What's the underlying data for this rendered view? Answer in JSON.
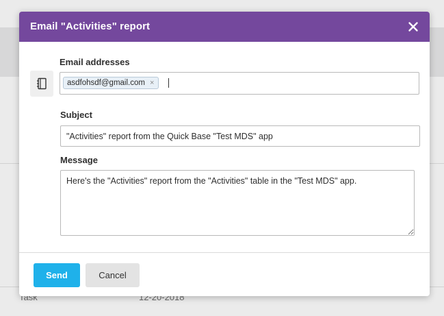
{
  "background": {
    "row_type": "Task",
    "row_date": "12-20-2018"
  },
  "dialog": {
    "title": "Email \"Activities\" report",
    "close_label": "×",
    "email": {
      "label": "Email addresses",
      "chips": [
        "asdfohsdf@gmail.com"
      ],
      "chip_remove": "×"
    },
    "subject": {
      "label": "Subject",
      "value": "\"Activities\" report from the Quick Base \"Test MDS\" app"
    },
    "message": {
      "label": "Message",
      "value": "Here's the \"Activities\" report from the \"Activities\" table in the \"Test MDS\" app."
    },
    "buttons": {
      "send": "Send",
      "cancel": "Cancel"
    }
  },
  "colors": {
    "header": "#74489d",
    "send_button": "#1fb1ea",
    "cancel_button": "#e3e3e3"
  },
  "icons": {
    "close": "close-icon",
    "address_book": "address-book-icon"
  }
}
